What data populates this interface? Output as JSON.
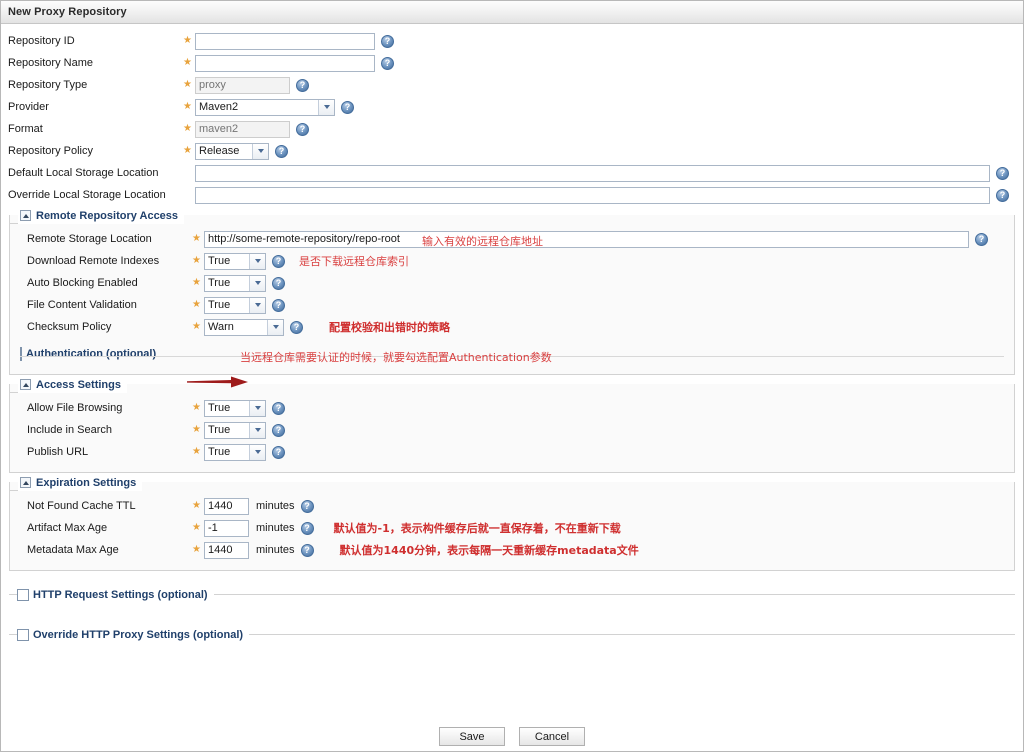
{
  "window": {
    "title": "New Proxy Repository"
  },
  "main_fields": [
    {
      "label": "Repository ID",
      "required": true,
      "control": "text",
      "value": "",
      "placeholder": "",
      "disabled": false,
      "width": "w-med",
      "help": true
    },
    {
      "label": "Repository Name",
      "required": true,
      "control": "text",
      "value": "",
      "placeholder": "",
      "disabled": false,
      "width": "w-med",
      "help": true
    },
    {
      "label": "Repository Type",
      "required": true,
      "control": "text",
      "value": "proxy",
      "placeholder": "proxy",
      "disabled": true,
      "width": "w-small",
      "help": true
    },
    {
      "label": "Provider",
      "required": true,
      "control": "select",
      "value": "Maven2",
      "width": "w-provider",
      "help": true
    },
    {
      "label": "Format",
      "required": true,
      "control": "text",
      "value": "maven2",
      "placeholder": "maven2",
      "disabled": true,
      "width": "w-small",
      "help": true
    },
    {
      "label": "Repository Policy",
      "required": true,
      "control": "select",
      "value": "Release",
      "width": "w-policy",
      "help": true
    },
    {
      "label": "Default Local Storage Location",
      "required": false,
      "control": "text",
      "value": "",
      "placeholder": "",
      "disabled": false,
      "width": "w-wide",
      "help": true
    },
    {
      "label": "Override Local Storage Location",
      "required": false,
      "control": "text",
      "value": "",
      "placeholder": "",
      "disabled": false,
      "width": "w-wide",
      "help": true
    }
  ],
  "remote_section": {
    "legend": "Remote Repository Access",
    "collapse_icon": "triangle-up-icon",
    "fields": [
      {
        "label": "Remote Storage Location",
        "required": true,
        "control": "text",
        "value": "http://some-remote-repository/repo-root",
        "width": "w-xwide",
        "help": true,
        "note": "输入有效的远程仓库地址"
      },
      {
        "label": "Download Remote Indexes",
        "required": true,
        "control": "select",
        "value": "True",
        "width": "w-bool",
        "help": true,
        "note": "是否下载远程仓库索引"
      },
      {
        "label": "Auto Blocking Enabled",
        "required": true,
        "control": "select",
        "value": "True",
        "width": "w-bool",
        "help": true,
        "note": ""
      },
      {
        "label": "File Content Validation",
        "required": true,
        "control": "select",
        "value": "True",
        "width": "w-bool",
        "help": true,
        "note": ""
      },
      {
        "label": "Checksum Policy",
        "required": true,
        "control": "select",
        "value": "Warn",
        "width": "w-check",
        "help": true,
        "note": "配置校验和出错时的策略"
      }
    ],
    "authentication": {
      "label": "Authentication (optional)",
      "checked": false,
      "note": "当远程仓库需要认证的时候，就要勾选配置Authentication参数",
      "arrow_icon": "right-arrow-icon"
    }
  },
  "access_section": {
    "legend": "Access Settings",
    "collapse_icon": "triangle-up-icon",
    "fields": [
      {
        "label": "Allow File Browsing",
        "required": true,
        "control": "select",
        "value": "True",
        "width": "w-bool",
        "help": true
      },
      {
        "label": "Include in Search",
        "required": true,
        "control": "select",
        "value": "True",
        "width": "w-bool",
        "help": true
      },
      {
        "label": "Publish URL",
        "required": true,
        "control": "select",
        "value": "True",
        "width": "w-bool",
        "help": true
      }
    ]
  },
  "expiration_section": {
    "legend": "Expiration Settings",
    "collapse_icon": "triangle-up-icon",
    "units": "minutes",
    "fields": [
      {
        "label": "Not Found Cache TTL",
        "required": true,
        "control": "text",
        "value": "1440",
        "width": "w-tiny",
        "help": true,
        "note": ""
      },
      {
        "label": "Artifact Max Age",
        "required": true,
        "control": "text",
        "value": "-1",
        "width": "w-tiny",
        "help": true,
        "note": "默认值为-1，表示构件缓存后就一直保存着，不在重新下载"
      },
      {
        "label": "Metadata Max Age",
        "required": true,
        "control": "text",
        "value": "1440",
        "width": "w-tiny",
        "help": true,
        "note": "默认值为1440分钟，表示每隔一天重新缓存metadata文件"
      }
    ]
  },
  "optional_sections": [
    {
      "label": "HTTP Request Settings (optional)",
      "checked": false
    },
    {
      "label": "Override HTTP Proxy Settings (optional)",
      "checked": false
    }
  ],
  "buttons": {
    "save": "Save",
    "cancel": "Cancel"
  },
  "icons": {
    "help": "?",
    "required_marker": "★"
  },
  "colors": {
    "legend": "#20406b",
    "note": "#d94040",
    "arrow": "#9e1b1b",
    "required": "#e8a33d"
  }
}
